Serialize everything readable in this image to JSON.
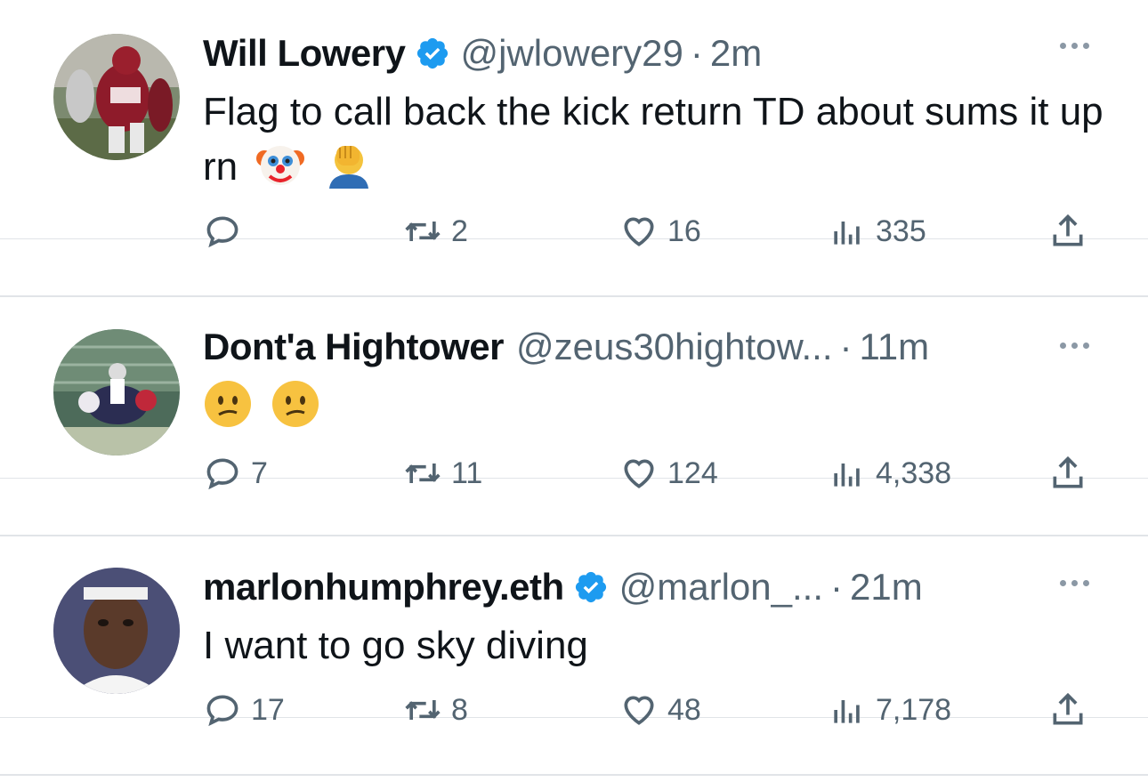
{
  "tweets": [
    {
      "name": "Will Lowery",
      "verified": true,
      "handle": "@jwlowery29",
      "dot": "·",
      "time": "2m",
      "text": "Flag to call back the kick return TD about sums it up rn",
      "emojis": [
        "clown-face-emoji",
        "face-palm-emoji"
      ],
      "replies": "",
      "retweets": "2",
      "likes": "16",
      "views": "335"
    },
    {
      "name": "Dont'a Hightower",
      "verified": false,
      "handle": "@zeus30hightow...",
      "dot": "·",
      "time": "11m",
      "text": "",
      "emojis": [
        "confused-face-emoji",
        "confused-face-emoji"
      ],
      "replies": "7",
      "retweets": "11",
      "likes": "124",
      "views": "4,338"
    },
    {
      "name": "marlonhumphrey.eth",
      "verified": true,
      "handle": "@marlon_...",
      "dot": "·",
      "time": "21m",
      "text": "I want to go sky diving",
      "emojis": [],
      "replies": "17",
      "retweets": "8",
      "likes": "48",
      "views": "7,178"
    }
  ],
  "colors": {
    "verified": "#1d9bf0",
    "secondary_text": "#536471",
    "primary_text": "#0f1419",
    "divider": "#e1e4e8"
  }
}
